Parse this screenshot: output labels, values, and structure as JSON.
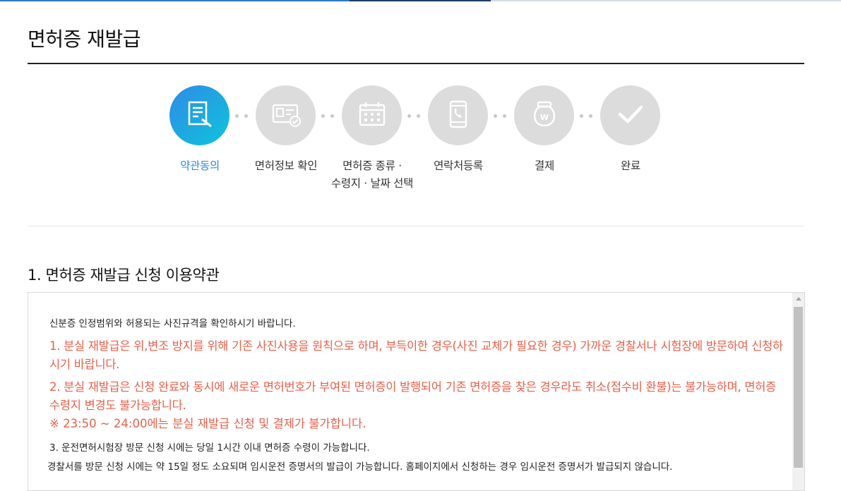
{
  "page": {
    "title": "면허증 재발급"
  },
  "steps": [
    {
      "label": "약관동의",
      "icon": "document-edit-icon",
      "active": true
    },
    {
      "label": "면허정보 확인",
      "icon": "license-card-icon",
      "active": false
    },
    {
      "label_line1": "면허증 종류 ·",
      "label_line2": "수령지 · 날짜 선택",
      "icon": "calendar-icon",
      "active": false
    },
    {
      "label": "연락처등록",
      "icon": "phone-icon",
      "active": false
    },
    {
      "label": "결제",
      "icon": "won-bag-icon",
      "active": false
    },
    {
      "label": "완료",
      "icon": "checkmark-icon",
      "active": false
    }
  ],
  "section": {
    "title": "1. 면허증 재발급 신청 이용약관",
    "intro": "신분증 인정범위와 허용되는 사진규격을 확인하시기 바랍니다.",
    "item1": "1. 분실 재발급은 위,변조 방지를 위해 기존 사진사용을 원칙으로 하며, 부득이한 경우(사진 교체가 필요한 경우) 가까운 경찰서나 시험장에 방문하여 신청하시기 바랍니다.",
    "item2": "2. 분실 재발급은 신청 완료와 동시에 새로운 면허번호가 부여된 면허증이 발행되어 기존 면허증을 찾은 경우라도 취소(접수비 환불)는 불가능하며, 면허증 수령지 변경도 불가능합니다.",
    "item2_note": "※ 23:50 ~ 24:00에는 분실 재발급 신청 및 결제가 불가합니다.",
    "item3": "3. 운전면허시험장 방문 신청 시에는 당일 1시간 이내 면허증 수령이 가능합니다.",
    "item3_extra": "경찰서를 방문 신청 시에는 약 15일 정도 소요되며 임시운전 증명서의 발급이 가능합니다. 홈페이지에서 신청하는 경우 임시운전 증명서가 발급되지 않습니다."
  },
  "colors": {
    "accent": "#2c86e0",
    "warning": "#e8604a",
    "inactive_circle": "#dcdcdc"
  }
}
